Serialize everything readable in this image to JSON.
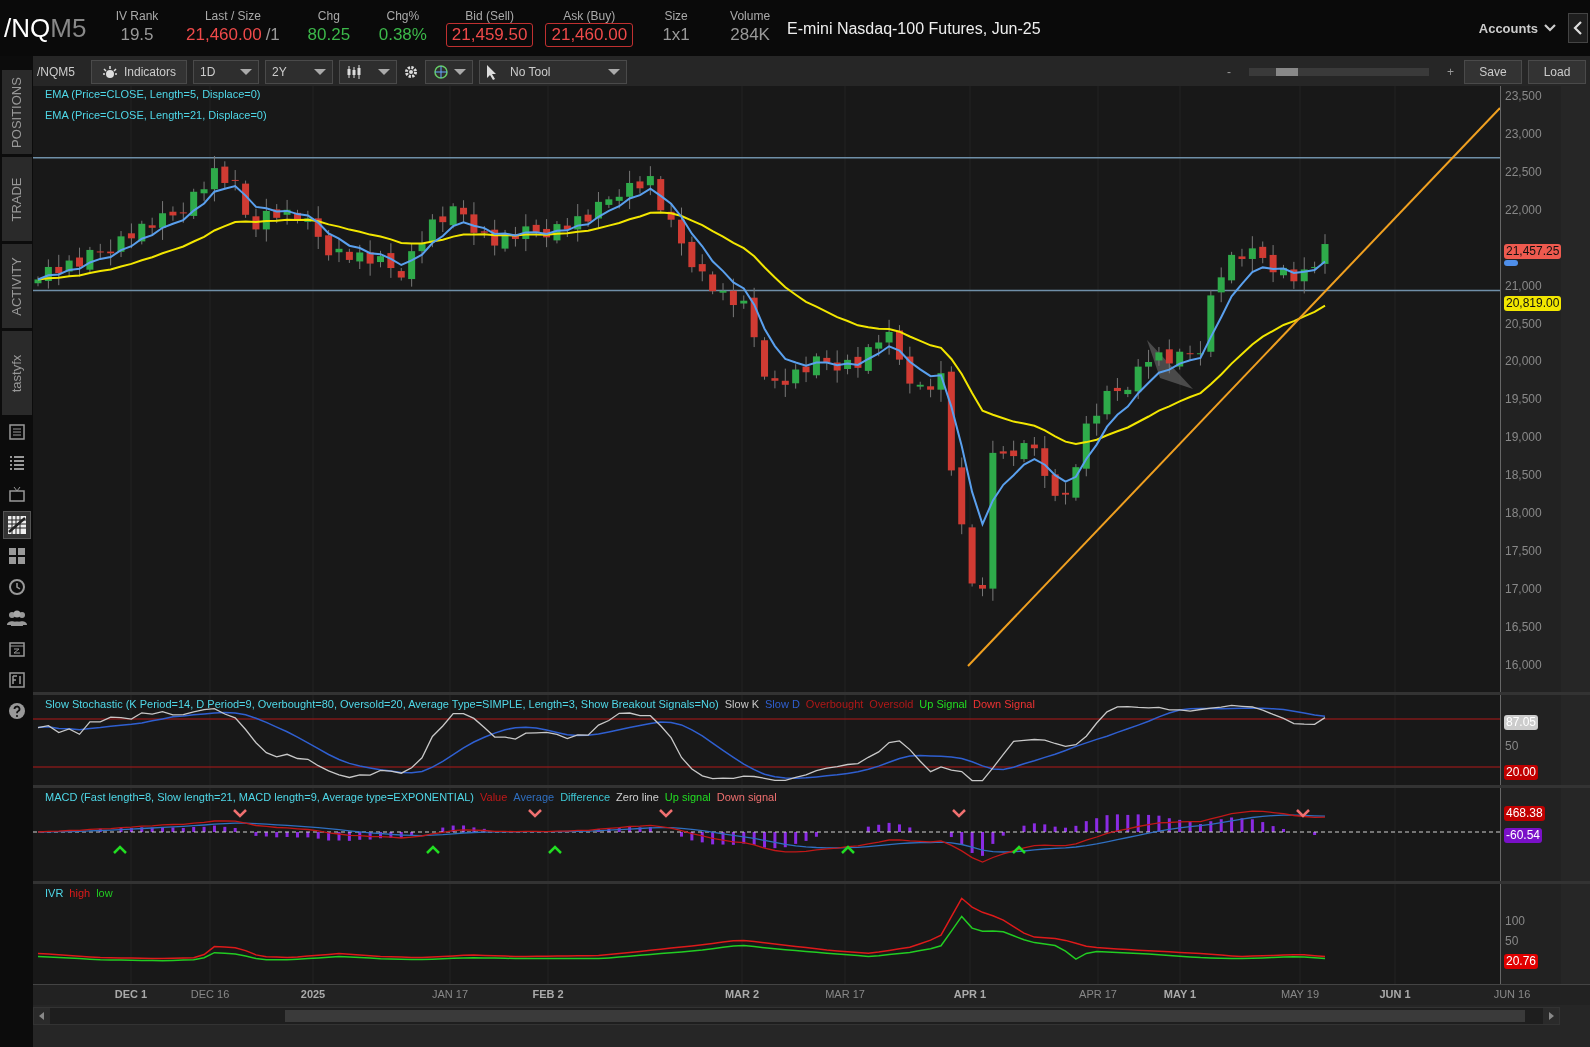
{
  "header": {
    "symbol": "/NQ",
    "symbol_suffix": "M5",
    "quotes": [
      {
        "label": "IV Rank",
        "value": "19.5",
        "color": "#999999",
        "boxed": false
      },
      {
        "label": "Last / Size",
        "value": "21,460.00",
        "size": "/1",
        "color": "#ef4a4a",
        "boxed": false
      },
      {
        "label": "Chg",
        "value": "80.25",
        "color": "#3cb84a",
        "boxed": false
      },
      {
        "label": "Chg%",
        "value": "0.38%",
        "color": "#3cb84a",
        "boxed": false
      },
      {
        "label": "Bid (Sell)",
        "value": "21,459.50",
        "color": "#ef4a4a",
        "boxed": true
      },
      {
        "label": "Ask (Buy)",
        "value": "21,460.00",
        "color": "#ef4a4a",
        "boxed": true
      },
      {
        "label": "Size",
        "value": "1x1",
        "color": "#999999",
        "boxed": false
      },
      {
        "label": "Volume",
        "value": "284K",
        "color": "#999999",
        "boxed": false
      }
    ],
    "description": "E-mini Nasdaq-100 Futures, Jun-25",
    "accounts": "Accounts"
  },
  "sidebar": {
    "tabs": [
      {
        "label": "POSITIONS"
      },
      {
        "label": "TRADE"
      },
      {
        "label": "ACTIVITY"
      },
      {
        "label": "tastyfx"
      }
    ],
    "icons": [
      {
        "kind": "news",
        "selected": false
      },
      {
        "kind": "list",
        "selected": false
      },
      {
        "kind": "tv",
        "selected": false
      },
      {
        "kind": "chart",
        "selected": true
      },
      {
        "kind": "grid",
        "selected": false
      },
      {
        "kind": "clock",
        "selected": false
      },
      {
        "kind": "people",
        "selected": false
      },
      {
        "kind": "calendar",
        "selected": false
      },
      {
        "kind": "fi",
        "selected": false
      },
      {
        "kind": "help",
        "selected": false
      }
    ]
  },
  "toolbar": {
    "symbol": "/NQM5",
    "indicators": "Indicators",
    "aggregation": "1D",
    "range": "2Y",
    "tool": "No Tool",
    "zoom_out": "-",
    "zoom_in": "+",
    "zoom": {
      "level": 0.15
    },
    "save": "Save",
    "load": "Load"
  },
  "price_pane": {
    "studies": [
      "EMA (Price=CLOSE, Length=5, Displace=0)",
      "EMA (Price=CLOSE, Length=21, Displace=0)"
    ],
    "axis": [
      "23,500",
      "23,000",
      "22,500",
      "22,000",
      "21,000",
      "20,500",
      "20,000",
      "19,500",
      "19,000",
      "18,500",
      "18,000",
      "17,500",
      "17,000",
      "16,500",
      "16,000"
    ],
    "badges": [
      {
        "text": "21,457.25",
        "color": "#ee5a4f"
      },
      {
        "color": "#4f8fea"
      },
      {
        "text": "20,819.00",
        "color": "#f2e600"
      }
    ]
  },
  "stochastic_pane": {
    "title": "Slow Stochastic (K Period=14, D Period=9, Overbought=80, Oversold=20, Average Type=SIMPLE, Length=3, Show Breakout Signals=No)",
    "legend": [
      {
        "text": "Slow K",
        "color": "#c8c8c8"
      },
      {
        "text": "Slow D",
        "color": "#2f5fd0"
      },
      {
        "text": "Overbought",
        "color": "#b01818"
      },
      {
        "text": "Oversold",
        "color": "#b01818"
      },
      {
        "text": "Up Signal",
        "color": "#22dd22"
      },
      {
        "text": "Down Signal",
        "color": "#ee3333"
      }
    ],
    "axis": [
      "50"
    ],
    "badges": [
      {
        "text": "87.05",
        "color": "#cccccc"
      },
      {
        "text": "20.00",
        "color": "#c00000"
      }
    ]
  },
  "macd_pane": {
    "title": "MACD (Fast length=8, Slow length=21, MACD length=9, Average type=EXPONENTIAL)",
    "legend": [
      {
        "text": "Value",
        "color": "#c01818"
      },
      {
        "text": "Average",
        "color": "#2f6fc0"
      },
      {
        "text": "Difference",
        "color": "#3ec9d6"
      },
      {
        "text": "Zero line",
        "color": "#d0d0d0"
      },
      {
        "text": "Up signal",
        "color": "#22dd22"
      },
      {
        "text": "Down signal",
        "color": "#f07070"
      }
    ],
    "badges": [
      {
        "text": "468.38",
        "color": "#c00000"
      },
      {
        "text": "-60.54",
        "color": "#7a10c8"
      }
    ]
  },
  "ivr_pane": {
    "title": "IVR",
    "legend": [
      {
        "text": "high",
        "color": "#dd1a1a"
      },
      {
        "text": "low",
        "color": "#22cc22"
      }
    ],
    "axis": [
      "100",
      "50"
    ],
    "badges": [
      {
        "text": "20.76",
        "color": "#e00000"
      }
    ]
  },
  "date_axis": [
    {
      "label": "DEC 1",
      "major": true
    },
    {
      "label": "DEC 16",
      "major": false
    },
    {
      "label": "2025",
      "major": true
    },
    {
      "label": "JAN 17",
      "major": false
    },
    {
      "label": "FEB 2",
      "major": true
    },
    {
      "label": "MAR 2",
      "major": true
    },
    {
      "label": "MAR 17",
      "major": false
    },
    {
      "label": "APR 1",
      "major": true
    },
    {
      "label": "APR 17",
      "major": false
    },
    {
      "label": "MAY 1",
      "major": true
    },
    {
      "label": "MAY 19",
      "major": false
    },
    {
      "label": "JUN 1",
      "major": true
    },
    {
      "label": "JUN 16",
      "major": false
    }
  ]
}
